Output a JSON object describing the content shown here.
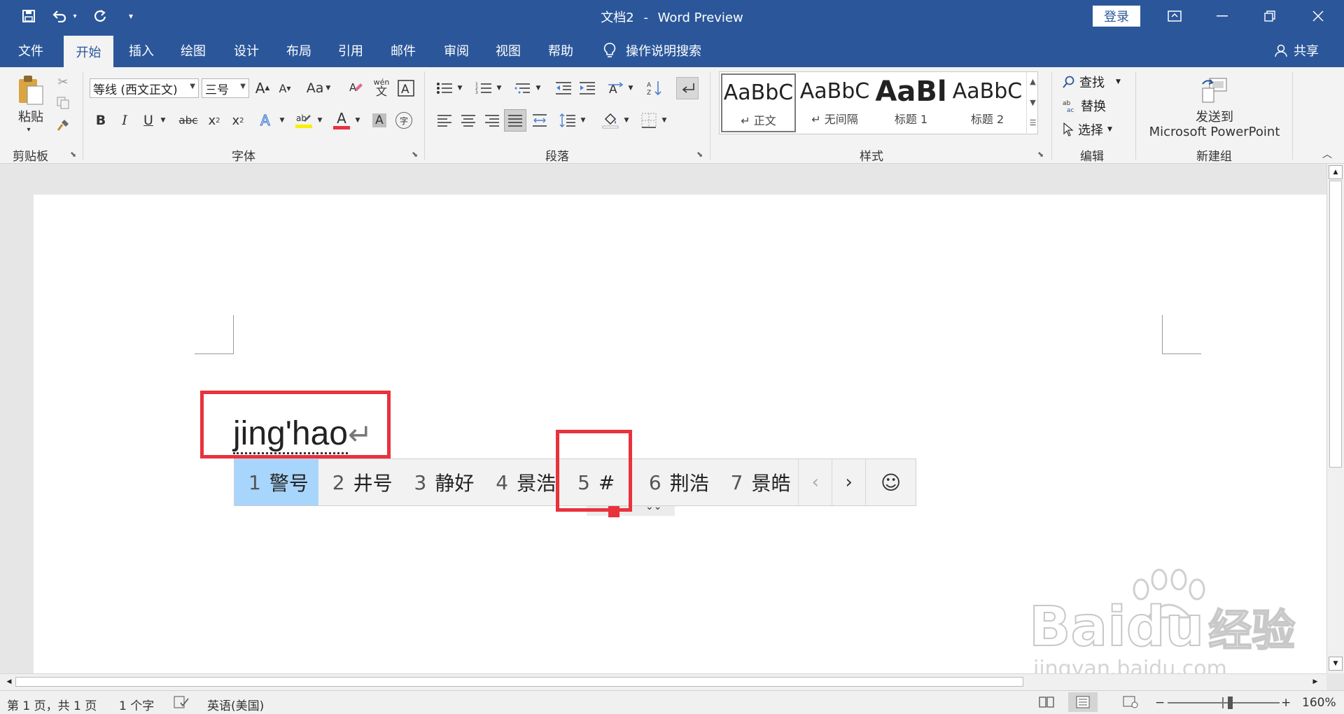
{
  "window": {
    "doc_name": "文档2",
    "separator": "-",
    "app_name": "Word Preview",
    "login_label": "登录"
  },
  "quick_access": {
    "save_icon": "save-icon",
    "undo_icon": "undo-icon",
    "redo_icon": "redo-icon",
    "customize_icon": "customize-icon"
  },
  "tabs": [
    "文件",
    "开始",
    "插入",
    "绘图",
    "设计",
    "布局",
    "引用",
    "邮件",
    "审阅",
    "视图",
    "帮助"
  ],
  "active_tab": "开始",
  "tell_me": "操作说明搜索",
  "share_label": "共享",
  "ribbon": {
    "clipboard": {
      "paste_label": "粘贴",
      "group_label": "剪贴板"
    },
    "font": {
      "font_name": "等线 (西文正文)",
      "font_size": "三号",
      "group_label": "字体",
      "grow": "A",
      "shrink": "A",
      "case": "Aa",
      "phonetic_top": "wén",
      "phonetic_bottom": "文",
      "bold": "B",
      "italic": "I",
      "underline": "U",
      "strike": "abc",
      "sub": "x",
      "sup": "x",
      "font_color": "A",
      "char_shade": "A",
      "enclose": "字"
    },
    "paragraph": {
      "group_label": "段落"
    },
    "styles": {
      "group_label": "样式",
      "items": [
        {
          "sample": "AaBbC",
          "name": "正文"
        },
        {
          "sample": "AaBbC",
          "name": "无间隔"
        },
        {
          "sample": "AaBl",
          "name": "标题 1"
        },
        {
          "sample": "AaBbC",
          "name": "标题 2"
        }
      ]
    },
    "editing": {
      "group_label": "编辑",
      "find": "查找",
      "replace": "替换",
      "select": "选择"
    },
    "newgroup": {
      "group_label": "新建组",
      "send_line1": "发送到",
      "send_line2": "Microsoft PowerPoint"
    }
  },
  "document": {
    "typed_text": "jing'hao"
  },
  "ime": {
    "candidates": [
      {
        "num": "1",
        "text": "警号"
      },
      {
        "num": "2",
        "text": "井号"
      },
      {
        "num": "3",
        "text": "静好"
      },
      {
        "num": "4",
        "text": "景浩"
      },
      {
        "num": "5",
        "text": "#"
      },
      {
        "num": "6",
        "text": "荆浩"
      },
      {
        "num": "7",
        "text": "景皓"
      }
    ],
    "prev": "‹",
    "next": "›",
    "emoji": "☺"
  },
  "status": {
    "page": "第 1 页，共 1 页",
    "words": "1 个字",
    "language": "英语(美国)",
    "zoom": "160%"
  },
  "watermark": {
    "brand": "Baidu",
    "brand_cn": "经验",
    "url": "jingyan.baidu.com"
  },
  "colors": {
    "brand_blue": "#2b579a",
    "annotation_red": "#e8323c",
    "candidate_highlight": "#a8d5fb"
  }
}
